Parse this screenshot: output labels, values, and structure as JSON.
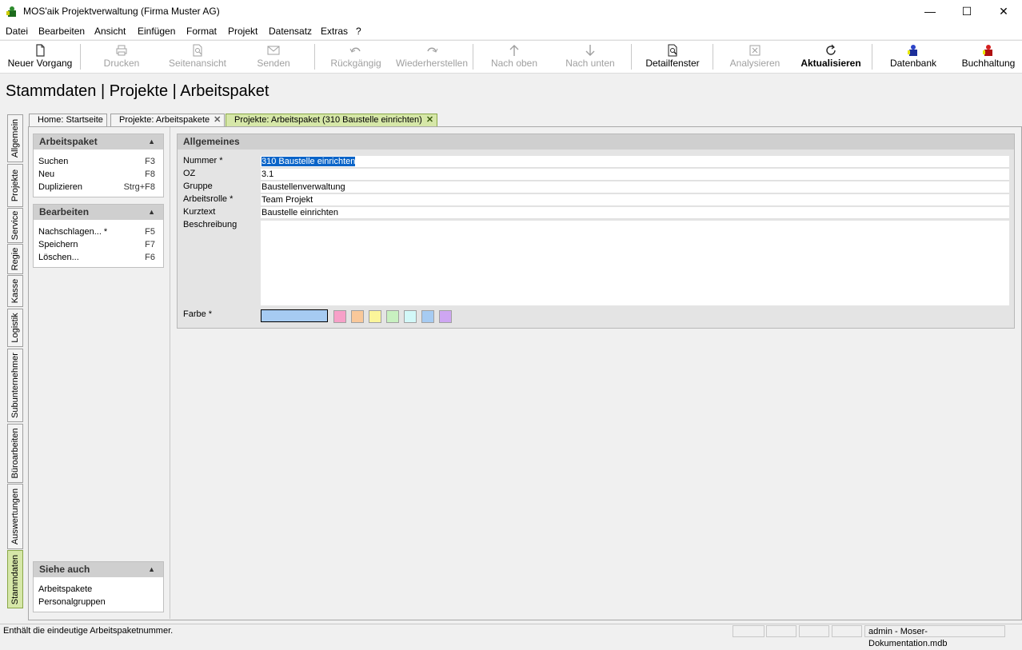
{
  "window": {
    "title": "MOS'aik Projektverwaltung (Firma Muster AG)",
    "min_glyph": "—",
    "max_glyph": "☐",
    "close_glyph": "✕"
  },
  "menu": [
    "Datei",
    "Bearbeiten",
    "Ansicht",
    "Einfügen",
    "Format",
    "Projekt",
    "Datensatz",
    "Extras",
    "?"
  ],
  "toolbar": {
    "new": "Neuer Vorgang",
    "print": "Drucken",
    "preview": "Seitenansicht",
    "send": "Senden",
    "undo": "Rückgängig",
    "redo": "Wiederherstellen",
    "up": "Nach oben",
    "down": "Nach unten",
    "detail": "Detailfenster",
    "analyze": "Analysieren",
    "refresh": "Aktualisieren",
    "database": "Datenbank",
    "accounting": "Buchhaltung"
  },
  "page_heading": "Stammdaten | Projekte | Arbeitspaket",
  "side_tabs": [
    "Allgemein",
    "Projekte",
    "Service",
    "Regie",
    "Kasse",
    "Logistik",
    "Subunternehmer",
    "Büroarbeiten",
    "Auswertungen",
    "Stammdaten"
  ],
  "doc_tabs": [
    {
      "label": "Home: Startseite"
    },
    {
      "label": "Projekte: Arbeitspakete",
      "close": "✕"
    },
    {
      "label": "Projekte: Arbeitspaket (310 Baustelle einrichten)",
      "close": "✕"
    }
  ],
  "left_panel": {
    "arbeitspaket": {
      "title": "Arbeitspaket",
      "items": [
        {
          "label": "Suchen",
          "key": "F3"
        },
        {
          "label": "Neu",
          "key": "F8"
        },
        {
          "label": "Duplizieren",
          "key": "Strg+F8"
        }
      ]
    },
    "bearbeiten": {
      "title": "Bearbeiten",
      "items": [
        {
          "label": "Nachschlagen... *",
          "key": "F5"
        },
        {
          "label": "Speichern",
          "key": "F7"
        },
        {
          "label": "Löschen...",
          "key": "F6"
        }
      ]
    },
    "siehe_auch": {
      "title": "Siehe auch",
      "items": [
        {
          "label": "Arbeitspakete"
        },
        {
          "label": "Personalgruppen"
        }
      ]
    },
    "caret": "▲"
  },
  "form": {
    "group_title": "Allgemeines",
    "nummer": {
      "label": "Nummer *",
      "value": "310 Baustelle einrichten"
    },
    "oz": {
      "label": "OZ",
      "value": "3.1"
    },
    "gruppe": {
      "label": "Gruppe",
      "value": "Baustellenverwaltung"
    },
    "arbeitsrolle": {
      "label": "Arbeitsrolle *",
      "value": "Team Projekt"
    },
    "kurztext": {
      "label": "Kurztext",
      "value": "Baustelle einrichten"
    },
    "beschreibung": {
      "label": "Beschreibung",
      "value": ""
    },
    "farbe": {
      "label": "Farbe *",
      "selected": "#a6cbf2",
      "swatches": [
        "#f7a0c8",
        "#f9c89a",
        "#fbf59a",
        "#c8f0c0",
        "#d2f8f8",
        "#a6cbf2",
        "#cea6f2"
      ]
    }
  },
  "statusbar": {
    "text": "Enthält die eindeutige Arbeitspaketnummer.",
    "db": "admin - Moser-Dokumentation.mdb"
  }
}
